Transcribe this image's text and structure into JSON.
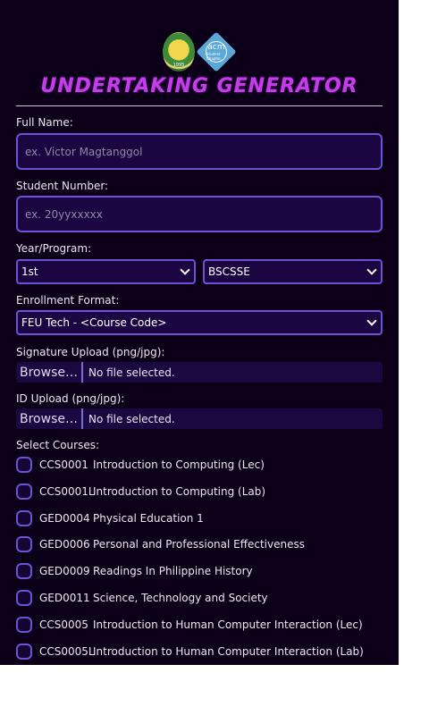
{
  "header": {
    "seal_year": "1995",
    "acm_logo_text": "acm",
    "acm_logo_subtext": "Student Chapter",
    "title": "UNDERTAKING GENERATOR"
  },
  "form": {
    "full_name": {
      "label": "Full Name:",
      "placeholder": "ex. Victor Magtanggol",
      "value": ""
    },
    "student_number": {
      "label": "Student Number:",
      "placeholder": "ex. 20yyxxxxx",
      "value": ""
    },
    "year_program": {
      "label": "Year/Program:",
      "year_value": "1st",
      "program_value": "BSCSSE"
    },
    "enrollment_format": {
      "label": "Enrollment Format:",
      "value": "FEU Tech - <Course Code>"
    },
    "signature_upload": {
      "label": "Signature Upload (png/jpg):",
      "button": "Browse…",
      "status": "No file selected."
    },
    "id_upload": {
      "label": "ID Upload (png/jpg):",
      "button": "Browse…",
      "status": "No file selected."
    },
    "courses_label": "Select Courses:",
    "courses": [
      {
        "code": "CCS0001",
        "name": "Introduction to Computing (Lec)",
        "checked": false
      },
      {
        "code": "CCS0001L",
        "name": "Introduction to Computing (Lab)",
        "checked": false
      },
      {
        "code": "GED0004",
        "name": "Physical Education 1",
        "checked": false
      },
      {
        "code": "GED0006",
        "name": "Personal and Professional Effectiveness",
        "checked": false
      },
      {
        "code": "GED0009",
        "name": "Readings In Philippine History",
        "checked": false
      },
      {
        "code": "GED0011",
        "name": "Science, Technology and Society",
        "checked": false
      },
      {
        "code": "CCS0005",
        "name": "Introduction to Human Computer Interaction (Lec)",
        "checked": false
      },
      {
        "code": "CCS0005L",
        "name": "Introduction to Human Computer Interaction (Lab)",
        "checked": false
      }
    ]
  },
  "colors": {
    "background": "#0c0018",
    "title": "#c23ee6",
    "input_border": "#6d52d8",
    "input_fill": "#1c0642",
    "text": "#ece6f2"
  }
}
